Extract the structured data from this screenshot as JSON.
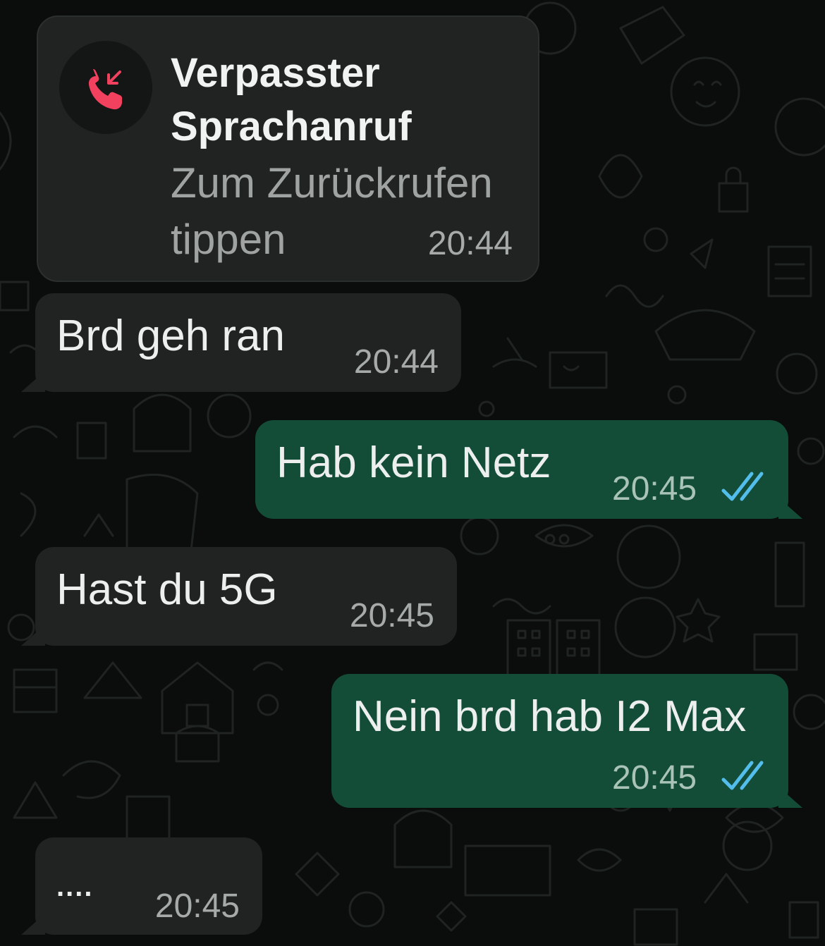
{
  "chat": {
    "call": {
      "title": "Verpasster Sprachanruf",
      "subtitle": "Zum Zurückrufen tippen",
      "time": "20:44",
      "icon": "missed-call-icon",
      "icon_color": "#f2415f"
    },
    "messages": [
      {
        "direction": "incoming",
        "text": "Brd geh ran",
        "time": "20:44"
      },
      {
        "direction": "outgoing",
        "text": "Hab kein Netz",
        "time": "20:45",
        "status": "read"
      },
      {
        "direction": "incoming",
        "text": "Hast du 5G",
        "time": "20:45"
      },
      {
        "direction": "outgoing",
        "text": "Nein brd hab I2 Max",
        "time": "20:45",
        "status": "read"
      },
      {
        "direction": "incoming",
        "text": "....",
        "time": "20:45"
      }
    ]
  },
  "colors": {
    "background": "#0b0d0c",
    "incoming_bubble": "#202322",
    "outgoing_bubble": "#134d37",
    "read_ticks": "#53bdeb",
    "missed_call": "#f2415f"
  }
}
